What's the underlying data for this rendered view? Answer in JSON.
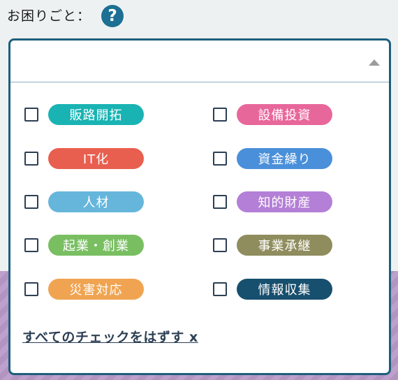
{
  "filter": {
    "label": "お困りごと：",
    "help_glyph": "?",
    "help_icon": "question-circle-icon",
    "accent": "#1d6f93",
    "border": "#1c5f7d"
  },
  "options": [
    {
      "label": "販路開拓",
      "color": "#1ab3b3",
      "checked": false
    },
    {
      "label": "設備投資",
      "color": "#e8679b",
      "checked": false
    },
    {
      "label": "IT化",
      "color": "#e85f4f",
      "checked": false
    },
    {
      "label": "資金繰り",
      "color": "#4a8fd9",
      "checked": false
    },
    {
      "label": "人材",
      "color": "#66b6dc",
      "checked": false
    },
    {
      "label": "知的財産",
      "color": "#b47fd6",
      "checked": false
    },
    {
      "label": "起業・創業",
      "color": "#79bf62",
      "checked": false
    },
    {
      "label": "事業承継",
      "color": "#8f8c5e",
      "checked": false
    },
    {
      "label": "災害対応",
      "color": "#f0a451",
      "checked": false
    },
    {
      "label": "情報収集",
      "color": "#174f6e",
      "checked": false
    }
  ],
  "clear_all_label": "すべてのチェックをはずす x"
}
